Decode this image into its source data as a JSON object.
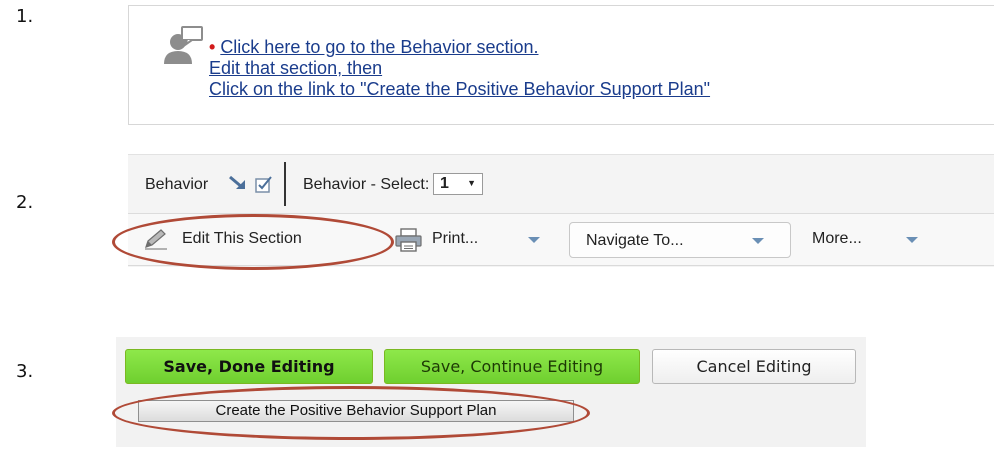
{
  "steps": {
    "s1": "1.",
    "s2": "2.",
    "s3": "3."
  },
  "panel1": {
    "icon": "person-speech-bubble-icon",
    "bullet": "•",
    "link1": "Click here to go to the Behavior section.",
    "link2": "Edit that section, then",
    "link3": "Click on the link to \"Create the Positive Behavior Support Plan\""
  },
  "panel2": {
    "section_label": "Behavior",
    "select_label": "Behavior - Select:",
    "select_value": "1",
    "toolbar": {
      "edit": "Edit This Section",
      "print": "Print...",
      "navigate": "Navigate To...",
      "more": "More..."
    }
  },
  "panel3": {
    "save_done": "Save, Done Editing",
    "save_continue": "Save, Continue Editing",
    "cancel": "Cancel Editing",
    "create_plan": "Create the Positive Behavior Support Plan"
  },
  "colors": {
    "link": "#1a3c8c",
    "bullet": "#d21a1a",
    "highlight_ellipse": "#b04a37",
    "green_button": "#7ad43a",
    "dropdown_arrow": "#6a8fb5"
  }
}
